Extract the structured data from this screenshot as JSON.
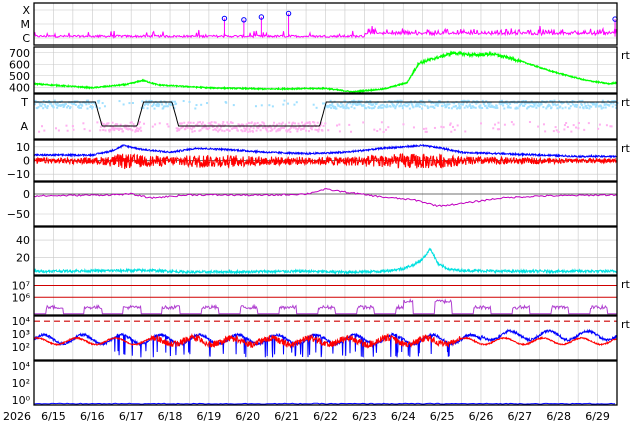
{
  "colors": {
    "flare": "#ff00ff",
    "flare_marker": "#0000ff",
    "wind_speed": "#00ff00",
    "polarity_toward": "#a0e0ff",
    "polarity_away": "#ffb0f0",
    "polarity_line": "#000000",
    "bt": "#0000ff",
    "bz": "#ff0000",
    "dst": "#c000c0",
    "density": "#00e0e0",
    "electron": "#b040d0",
    "proton_hi": "#0000ff",
    "proton_lo": "#ff0000",
    "threshold": "#d00000",
    "grid": "#c8c8c8",
    "frame": "#000000"
  },
  "chart_data": {
    "type": "line",
    "x_start_label": "2026",
    "x_ticks": [
      "6/15",
      "6/16",
      "6/17",
      "6/18",
      "6/19",
      "6/20",
      "6/21",
      "6/22",
      "6/23",
      "6/24",
      "6/25",
      "6/26",
      "6/27",
      "6/28",
      "6/29"
    ],
    "x_range_days": [
      0,
      15
    ],
    "panels": [
      {
        "name": "xray-flare-class",
        "y_ticks": [
          "X",
          "M",
          "C"
        ],
        "ylim": [
          0,
          3
        ],
        "series": [
          {
            "color_key": "flare"
          }
        ],
        "markers_days": [
          4.9,
          5.4,
          5.85,
          6.55,
          14.95
        ]
      },
      {
        "name": "solar-wind-speed",
        "y_ticks": [
          "700",
          "600",
          "500",
          "400"
        ],
        "ylim": [
          350,
          750
        ],
        "grid": true,
        "series": [
          {
            "color_key": "wind_speed"
          }
        ],
        "key": [
          [
            0,
            430
          ],
          [
            1.5,
            395
          ],
          [
            2.4,
            425
          ],
          [
            2.8,
            460
          ],
          [
            3.2,
            420
          ],
          [
            4.5,
            395
          ],
          [
            6,
            385
          ],
          [
            7.5,
            390
          ],
          [
            8.2,
            360
          ],
          [
            9,
            385
          ],
          [
            9.6,
            440
          ],
          [
            9.9,
            610
          ],
          [
            10.3,
            650
          ],
          [
            10.8,
            700
          ],
          [
            11.3,
            680
          ],
          [
            11.8,
            690
          ],
          [
            12.4,
            640
          ],
          [
            13.3,
            540
          ],
          [
            14.2,
            460
          ],
          [
            14.8,
            430
          ],
          [
            15,
            440
          ]
        ],
        "right_mark": "rt"
      },
      {
        "name": "imf-polarity",
        "y_ticks": [
          "T",
          "A"
        ],
        "series": [
          {
            "color_key": "polarity_toward"
          },
          {
            "color_key": "polarity_away"
          }
        ],
        "key": [
          [
            0,
            1
          ],
          [
            1.58,
            1
          ],
          [
            1.75,
            0
          ],
          [
            2.65,
            0
          ],
          [
            2.82,
            1
          ],
          [
            3.55,
            1
          ],
          [
            3.72,
            0
          ],
          [
            7.35,
            0
          ],
          [
            7.52,
            1
          ],
          [
            15,
            1
          ]
        ],
        "right_mark": "rt"
      },
      {
        "name": "imf-bt-bz",
        "y_ticks": [
          "10",
          "0",
          "−10"
        ],
        "ylim": [
          -15,
          15
        ],
        "series": [
          {
            "name": "",
            "color_key": "bt"
          },
          {
            "name": "",
            "color_key": "bz"
          }
        ],
        "bt_key": [
          [
            0,
            4
          ],
          [
            1.5,
            4
          ],
          [
            2.0,
            7
          ],
          [
            2.3,
            11
          ],
          [
            2.8,
            8
          ],
          [
            3.5,
            6
          ],
          [
            4.2,
            9
          ],
          [
            5,
            8
          ],
          [
            6,
            6
          ],
          [
            7,
            5
          ],
          [
            8,
            6
          ],
          [
            9,
            9
          ],
          [
            9.5,
            10
          ],
          [
            10,
            11
          ],
          [
            10.5,
            9
          ],
          [
            11,
            6
          ],
          [
            12,
            5
          ],
          [
            13,
            4
          ],
          [
            14,
            3
          ],
          [
            15,
            3
          ]
        ],
        "right_mark": "rt"
      },
      {
        "name": "dst-index",
        "y_ticks": [
          "0",
          "−50"
        ],
        "ylim": [
          -80,
          30
        ],
        "series": [
          {
            "color_key": "dst"
          }
        ],
        "key": [
          [
            0,
            -5
          ],
          [
            2,
            -2
          ],
          [
            2.5,
            0
          ],
          [
            3,
            -10
          ],
          [
            4,
            -2
          ],
          [
            6,
            -3
          ],
          [
            7,
            0
          ],
          [
            7.5,
            12
          ],
          [
            8,
            5
          ],
          [
            9,
            -8
          ],
          [
            9.8,
            -15
          ],
          [
            10.4,
            -30
          ],
          [
            11,
            -24
          ],
          [
            12,
            -10
          ],
          [
            13,
            -5
          ],
          [
            15,
            -2
          ]
        ]
      },
      {
        "name": "solar-wind-density",
        "y_ticks": [
          "40",
          "20"
        ],
        "ylim": [
          0,
          55
        ],
        "series": [
          {
            "color_key": "density"
          }
        ],
        "key": [
          [
            0,
            4
          ],
          [
            3,
            5
          ],
          [
            4,
            3
          ],
          [
            7,
            4
          ],
          [
            8,
            3
          ],
          [
            9,
            4
          ],
          [
            9.5,
            7
          ],
          [
            9.8,
            12
          ],
          [
            10,
            18
          ],
          [
            10.2,
            30
          ],
          [
            10.4,
            12
          ],
          [
            10.7,
            6
          ],
          [
            11,
            5
          ],
          [
            12,
            4
          ],
          [
            15,
            4
          ]
        ]
      },
      {
        "name": "electron-flux",
        "y_ticks": [
          "10⁷",
          "10⁶"
        ],
        "thresholds": [
          7,
          6
        ],
        "series": [
          {
            "color_key": "electron"
          }
        ],
        "right_mark": "rt"
      },
      {
        "name": "proton-flux",
        "y_ticks": [
          "10⁴",
          "10³",
          "10²"
        ],
        "threshold": 4,
        "series": [
          {
            "color_key": "proton_hi"
          },
          {
            "color_key": "proton_lo"
          }
        ],
        "right_mark": "rt"
      },
      {
        "name": "high-energy-proton",
        "y_ticks": [
          "10⁴",
          "10²",
          "10⁰"
        ],
        "series": [
          {
            "color_key": "proton_hi"
          }
        ]
      }
    ]
  }
}
